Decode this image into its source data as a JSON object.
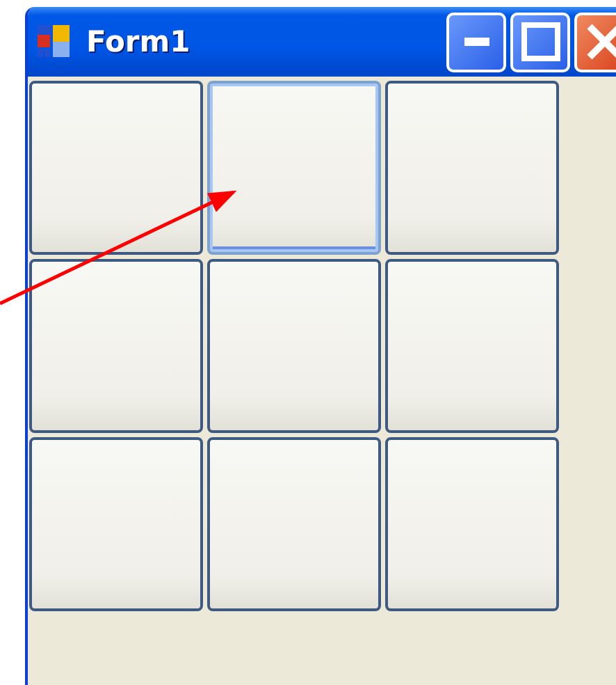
{
  "window": {
    "title": "Form1"
  },
  "buttons": [
    {
      "selected": false
    },
    {
      "selected": true
    },
    {
      "selected": false
    },
    {
      "selected": false
    },
    {
      "selected": false
    },
    {
      "selected": false
    },
    {
      "selected": false
    },
    {
      "selected": false
    },
    {
      "selected": false
    }
  ]
}
